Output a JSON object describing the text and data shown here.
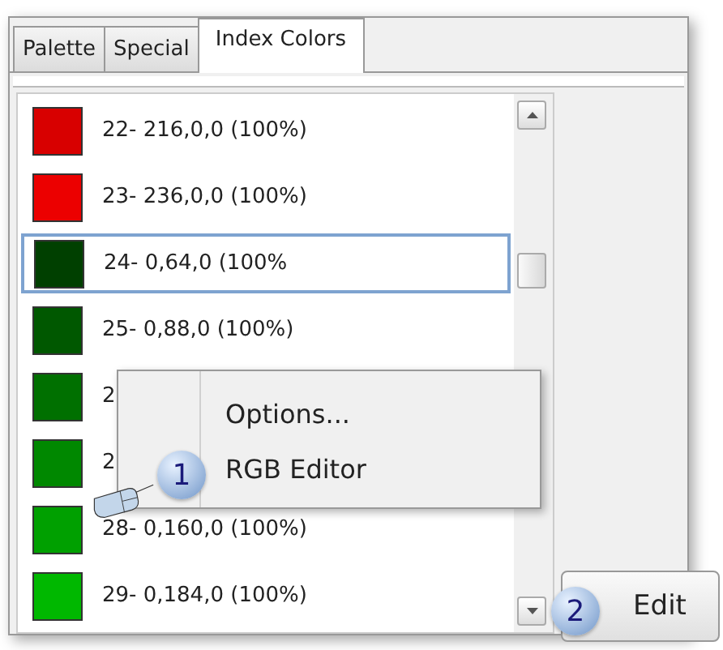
{
  "tabs": [
    {
      "label": "Palette",
      "selected": false
    },
    {
      "label": "Special",
      "selected": false
    },
    {
      "label": "Index Colors",
      "selected": true
    }
  ],
  "colors": [
    {
      "label": "22- 216,0,0 (100%)",
      "color": "#d80000",
      "selected": false
    },
    {
      "label": "23- 236,0,0 (100%)",
      "color": "#ec0000",
      "selected": false
    },
    {
      "label": "24- 0,64,0 (100%",
      "color": "#004000",
      "selected": true
    },
    {
      "label": "25- 0,88,0 (100%)",
      "color": "#005800",
      "selected": false
    },
    {
      "label": "2",
      "color": "#007000",
      "selected": false
    },
    {
      "label": "2",
      "color": "#008800",
      "selected": false
    },
    {
      "label": "28- 0,160,0 (100%)",
      "color": "#00a000",
      "selected": false
    },
    {
      "label": "29- 0,184,0 (100%)",
      "color": "#00b800",
      "selected": false
    }
  ],
  "context_menu": {
    "items": [
      "Options...",
      "RGB Editor"
    ]
  },
  "callouts": [
    "1",
    "2"
  ],
  "edit_button": {
    "label": "Edit"
  }
}
